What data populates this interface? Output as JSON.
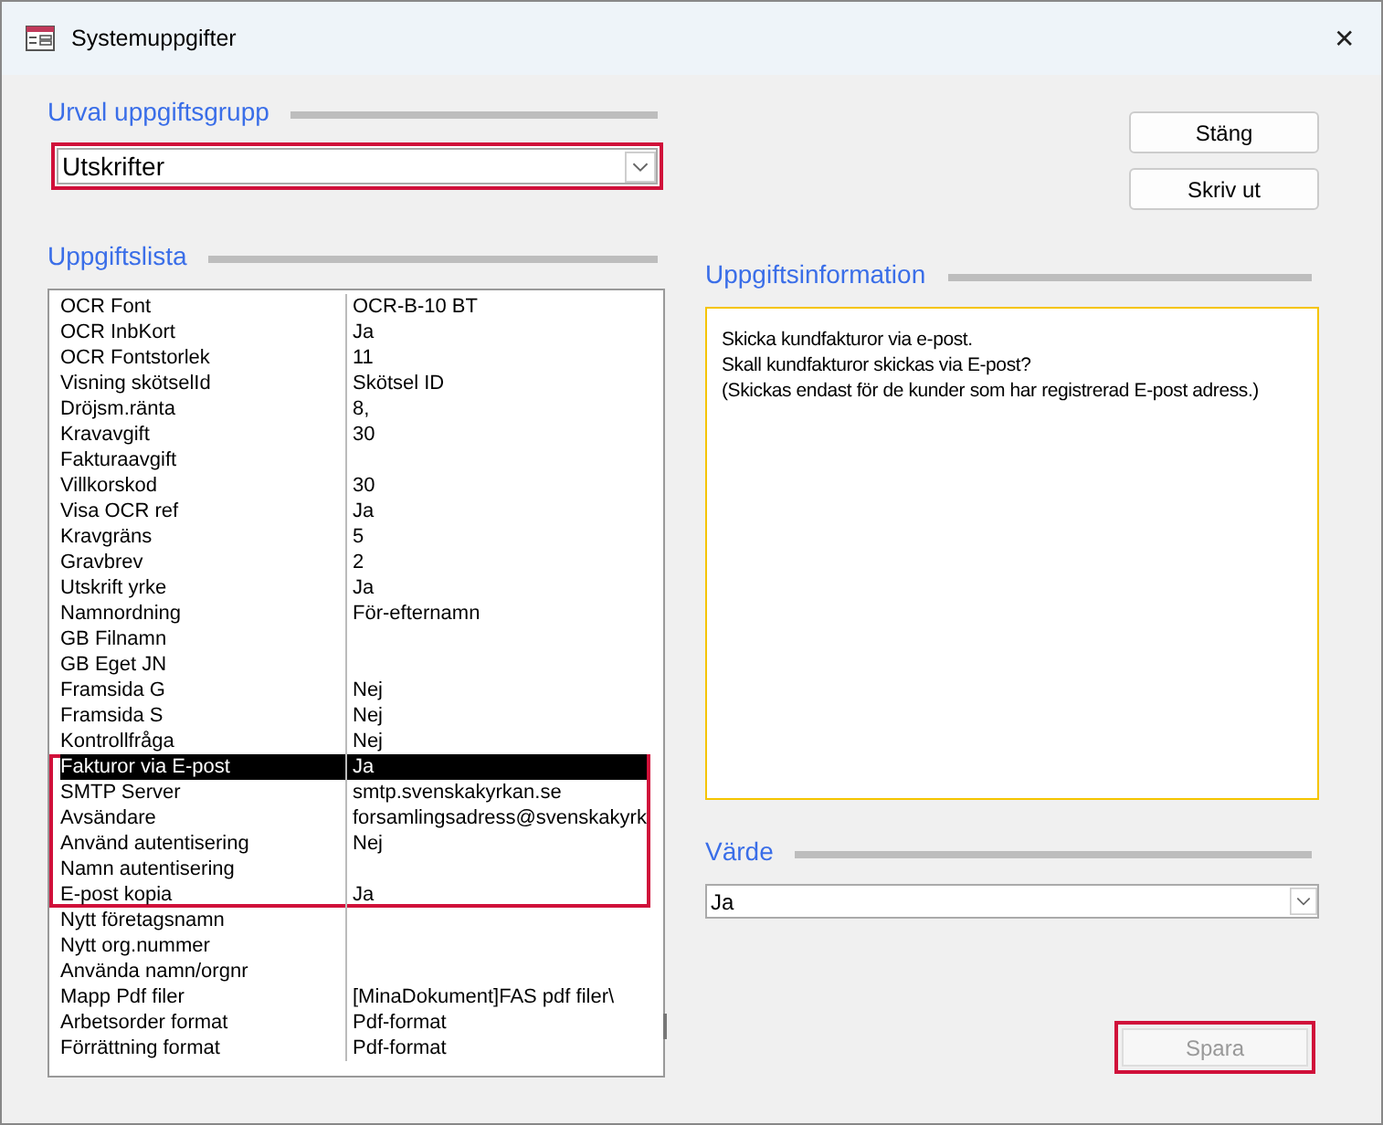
{
  "window": {
    "title": "Systemuppgifter",
    "close": "✕"
  },
  "group_section": {
    "title": "Urval uppgiftsgrupp",
    "combo": {
      "value": "Utskrifter",
      "highlighted": true
    }
  },
  "buttons": [
    {
      "label": "Stäng",
      "disabled": false,
      "highlighted": false
    },
    {
      "label": "Skriv ut",
      "disabled": false,
      "highlighted": false
    }
  ],
  "list_section": {
    "title": "Uppgiftslista",
    "rows": [
      {
        "name": "OCR Font",
        "value": "OCR-B-10 BT",
        "selected": false,
        "highlighted": false
      },
      {
        "name": "OCR InbKort",
        "value": "Ja",
        "selected": false,
        "highlighted": false
      },
      {
        "name": "OCR Fontstorlek",
        "value": "11",
        "selected": false,
        "highlighted": false
      },
      {
        "name": "Visning skötselId",
        "value": "Skötsel ID",
        "selected": false,
        "highlighted": false
      },
      {
        "name": "Dröjsm.ränta",
        "value": "8,",
        "selected": false,
        "highlighted": false
      },
      {
        "name": "Kravavgift",
        "value": "30",
        "selected": false,
        "highlighted": false
      },
      {
        "name": "Fakturaavgift",
        "selected": false,
        "highlighted": false
      },
      {
        "name": "Villkorskod",
        "value": "30",
        "selected": false,
        "highlighted": false
      },
      {
        "name": "Visa OCR ref",
        "value": "Ja",
        "selected": false,
        "highlighted": false
      },
      {
        "name": "Kravgräns",
        "value": "5",
        "selected": false,
        "highlighted": false
      },
      {
        "name": "Gravbrev",
        "value": "2",
        "selected": false,
        "highlighted": false
      },
      {
        "name": "Utskrift yrke",
        "value": "Ja",
        "selected": false,
        "highlighted": false
      },
      {
        "name": "Namnordning",
        "value": "För-efternamn",
        "selected": false,
        "highlighted": false
      },
      {
        "name": "GB Filnamn",
        "selected": false,
        "highlighted": false
      },
      {
        "name": "GB Eget JN",
        "selected": false,
        "highlighted": false
      },
      {
        "name": "Framsida G",
        "value": "Nej",
        "selected": false,
        "highlighted": false
      },
      {
        "name": "Framsida S",
        "value": "Nej",
        "selected": false,
        "highlighted": false
      },
      {
        "name": "Kontrollfråga",
        "value": "Nej",
        "selected": false,
        "highlighted": false
      },
      {
        "name": "Fakturor via E-post",
        "value": "Ja",
        "selected": true,
        "highlighted": true
      },
      {
        "name": "SMTP Server",
        "value": "smtp.svenskakyrkan.se",
        "selected": false,
        "highlighted": true
      },
      {
        "name": "Avsändare",
        "value": "forsamlingsadress@svenskakyrk",
        "selected": false,
        "highlighted": true
      },
      {
        "name": "Använd autentisering",
        "value": "Nej",
        "selected": false,
        "highlighted": true
      },
      {
        "name": "Namn autentisering",
        "selected": false,
        "highlighted": true
      },
      {
        "name": "E-post kopia",
        "value": "Ja",
        "selected": false,
        "highlighted": true
      },
      {
        "name": "Nytt företagsnamn",
        "selected": false,
        "highlighted": false
      },
      {
        "name": "Nytt org.nummer",
        "selected": false,
        "highlighted": false
      },
      {
        "name": "Använda namn/orgnr",
        "selected": false,
        "highlighted": false
      },
      {
        "name": "Mapp Pdf filer",
        "value": "[MinaDokument]FAS pdf filer\\",
        "selected": false,
        "highlighted": false
      },
      {
        "name": "Arbetsorder format",
        "value": "Pdf-format",
        "selected": false,
        "highlighted": false
      },
      {
        "name": "Förrättning format",
        "value": "Pdf-format",
        "selected": false,
        "highlighted": false
      }
    ]
  },
  "info_section": {
    "title": "Uppgiftsinformation",
    "lines": [
      "Skicka kundfakturor via e-post.",
      "Skall kundfakturor skickas via E-post?",
      "(Skickas endast för de kunder som har registrerad E-post adress.)"
    ]
  },
  "value_section": {
    "title": "Värde",
    "combo": {
      "value": "Ja",
      "highlighted": false
    }
  },
  "save_button": {
    "label": "Spara",
    "disabled": true,
    "highlighted": true
  }
}
